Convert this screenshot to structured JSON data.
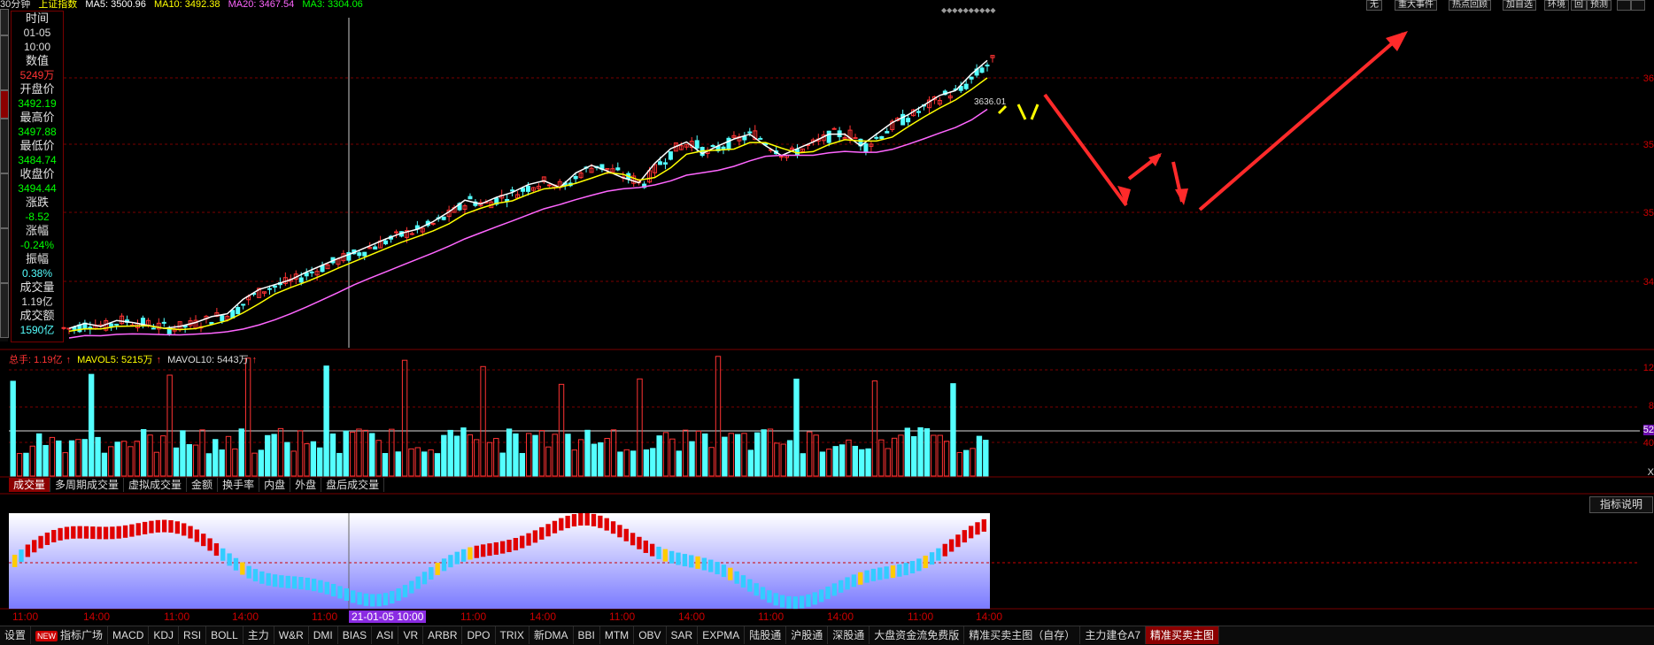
{
  "topbar": {
    "period": "30分钟",
    "index_name": "上证指数",
    "ma5": "MA5: 3500.96",
    "ma10": "MA10: 3492.38",
    "ma20": "MA20: 3467.54",
    "ma60": "MA3: 3304.06",
    "buttons": [
      "无",
      "重大事件",
      "热点回顾",
      "加自选",
      "环境",
      "回",
      "预测"
    ]
  },
  "info": {
    "time_label": "时间",
    "date": "01-05",
    "time": "10:00",
    "value_label": "数值",
    "value": "5249万",
    "open_label": "开盘价",
    "open": "3492.19",
    "high_label": "最高价",
    "high": "3497.88",
    "low_label": "最低价",
    "low": "3484.74",
    "close_label": "收盘价",
    "close": "3494.44",
    "change_label": "涨跌",
    "change": "-8.52",
    "pct_label": "涨幅",
    "pct": "-0.24%",
    "amp_label": "振幅",
    "amp": "0.38%",
    "vol_label": "成交量",
    "vol": "1.19亿",
    "amt_label": "成交额",
    "amt": "1590亿"
  },
  "price_labels": [
    "36",
    "35",
    "35",
    "34"
  ],
  "last_price": "3636.01",
  "volume_header": {
    "total": "总手: 1.19亿",
    "mavol5": "MAVOL5: 5215万",
    "mavol10": "MAVOL10: 5443万"
  },
  "volume_axis": [
    "12",
    "8",
    "52",
    "40",
    "X"
  ],
  "volume_tabs": [
    "成交量",
    "多周期成交量",
    "虚拟成交量",
    "金额",
    "换手率",
    "内盘",
    "外盘",
    "盘后成交量"
  ],
  "indicator_button": "指标说明",
  "time_axis": {
    "labels": [
      "11:00",
      "14:00",
      "11:00",
      "14:00",
      "11:00",
      "11:00",
      "14:00",
      "11:00",
      "14:00",
      "11:00",
      "14:00",
      "11:00",
      "14:00"
    ],
    "cursor": "21-01-05 10:00"
  },
  "bottom_tabs": [
    "设置",
    "指标广场",
    "MACD",
    "KDJ",
    "RSI",
    "BOLL",
    "主力",
    "W&R",
    "DMI",
    "BIAS",
    "ASI",
    "VR",
    "ARBR",
    "DPO",
    "TRIX",
    "新DMA",
    "BBI",
    "MTM",
    "OBV",
    "SAR",
    "EXPMA",
    "陆股通",
    "沪股通",
    "深股通",
    "大盘资金流免费版",
    "精准买卖主图（自存）",
    "主力建仓A7",
    "精准买卖主图"
  ],
  "new_badge": "NEW",
  "colors": {
    "up": "#ff3333",
    "down": "#54ffff",
    "ma5": "#ffffff",
    "ma10": "#ffff00",
    "ma20": "#ff66ff",
    "arrow": "#ff2a2a",
    "yellow_arrow": "#ffff00"
  },
  "chart_data": {
    "type": "line",
    "title": "",
    "series": [
      {
        "name": "上证指数",
        "values": [
          3360,
          3365,
          3362,
          3368,
          3366,
          3363,
          3360,
          3362,
          3366,
          3372,
          3375,
          3390,
          3400,
          3405,
          3410,
          3418,
          3425,
          3432,
          3438,
          3445,
          3452,
          3458,
          3462,
          3470,
          3480,
          3492,
          3488,
          3495,
          3500,
          3508,
          3512,
          3505,
          3520,
          3528,
          3522,
          3515,
          3510,
          3530,
          3545,
          3552,
          3540,
          3548,
          3555,
          3560,
          3548,
          3538,
          3545,
          3552,
          3560,
          3560,
          3548,
          3560,
          3572,
          3580,
          3590,
          3600,
          3605,
          3622,
          3636
        ]
      },
      {
        "name": "MA5",
        "values": []
      },
      {
        "name": "MA10",
        "values": []
      },
      {
        "name": "MA20",
        "values": []
      }
    ],
    "ylim": [
      3340,
      3680
    ]
  }
}
